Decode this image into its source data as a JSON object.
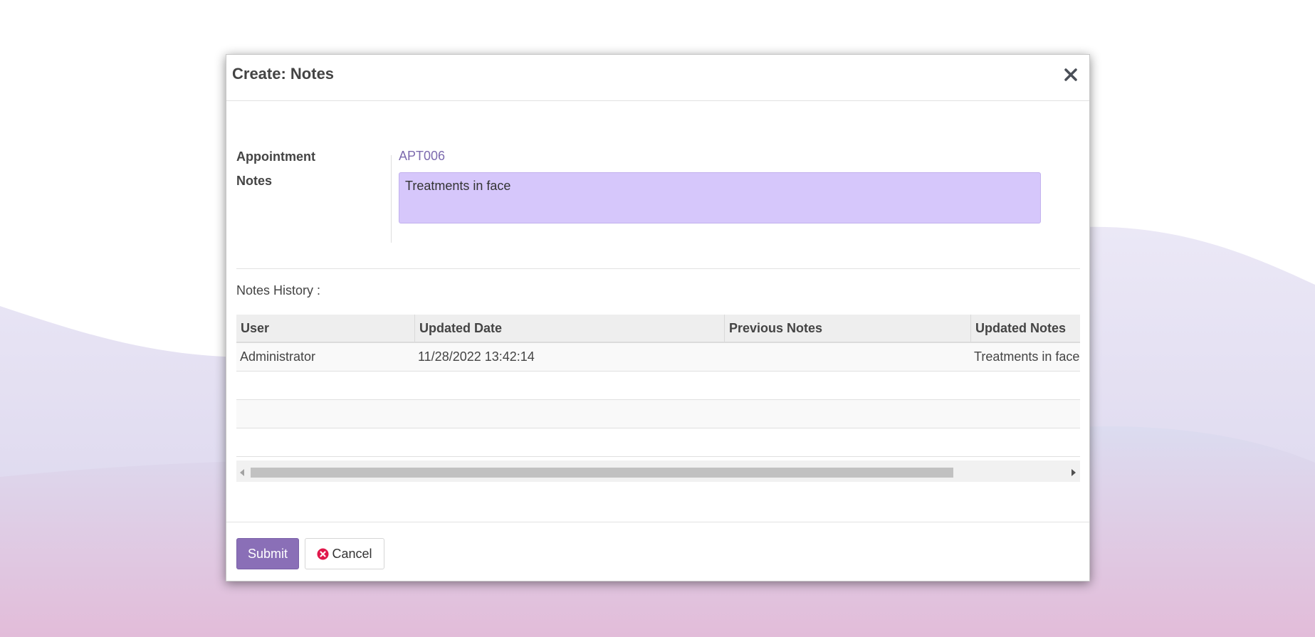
{
  "colors": {
    "accent": "#8a6fb7",
    "link": "#7c6aae",
    "notes_field_bg": "#d6c7fb",
    "cancel_icon": "#e0174a"
  },
  "modal": {
    "title": "Create: Notes",
    "close_icon": "close-icon"
  },
  "form": {
    "appointment_label": "Appointment",
    "appointment_value": "APT006",
    "notes_label": "Notes",
    "notes_value": "Treatments in face"
  },
  "history": {
    "label": "Notes History :",
    "columns": [
      "User",
      "Updated Date",
      "Previous Notes",
      "Updated Notes"
    ],
    "rows": [
      {
        "user": "Administrator",
        "updated_date": "11/28/2022 13:42:14",
        "previous_notes": "",
        "updated_notes": "Treatments in face"
      }
    ]
  },
  "footer": {
    "submit_label": "Submit",
    "cancel_label": "Cancel",
    "cancel_icon": "times-circle-icon"
  }
}
